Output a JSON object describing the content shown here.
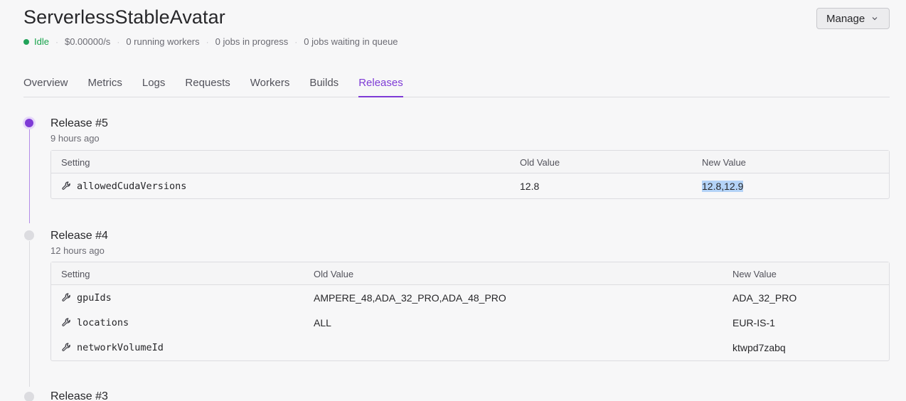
{
  "header": {
    "title": "ServerlessStableAvatar",
    "manage_label": "Manage",
    "status": {
      "state": "Idle",
      "cost": "$0.00000/s",
      "running_workers": "0 running workers",
      "jobs_in_progress": "0 jobs in progress",
      "jobs_in_queue": "0 jobs waiting in queue"
    }
  },
  "tabs": [
    "Overview",
    "Metrics",
    "Logs",
    "Requests",
    "Workers",
    "Builds",
    "Releases"
  ],
  "active_tab": "Releases",
  "columns": {
    "setting": "Setting",
    "old": "Old Value",
    "new": "New Value"
  },
  "releases": [
    {
      "title": "Release #5",
      "time": "9 hours ago",
      "rows": [
        {
          "setting": "allowedCudaVersions",
          "old": "12.8",
          "new": "12.8,12.9"
        }
      ]
    },
    {
      "title": "Release #4",
      "time": "12 hours ago",
      "rows": [
        {
          "setting": "gpuIds",
          "old": "AMPERE_48,ADA_32_PRO,ADA_48_PRO",
          "new": "ADA_32_PRO"
        },
        {
          "setting": "locations",
          "old": "ALL",
          "new": "EUR-IS-1"
        },
        {
          "setting": "networkVolumeId",
          "old": "",
          "new": "ktwpd7zabq"
        }
      ]
    },
    {
      "title": "Release #3"
    }
  ],
  "colors": {
    "accent": "#7e3bd6",
    "status_idle": "#16a34a",
    "selection": "#b4d3f7"
  },
  "icons": {
    "setting_row": "wrench-icon",
    "manage_button": "chevron-down-icon"
  }
}
